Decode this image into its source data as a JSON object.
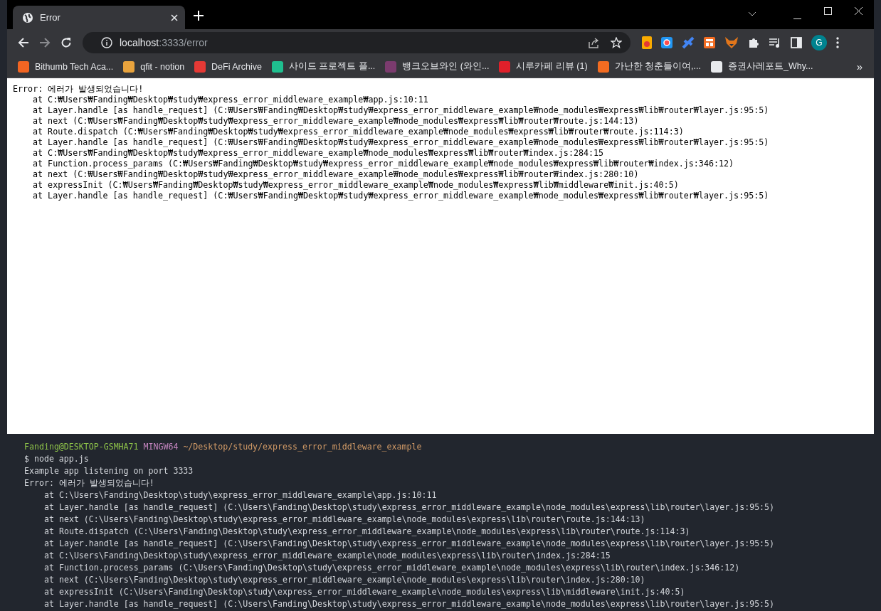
{
  "tab": {
    "title": "Error",
    "selected": true
  },
  "address": {
    "host": "localhost",
    "rest": ":3333/error"
  },
  "profile": {
    "initial": "G"
  },
  "bookmarks": [
    {
      "label": "Bithumb Tech Aca...",
      "color": "#f26522"
    },
    {
      "label": "qfit - notion",
      "color": "#e8a33d"
    },
    {
      "label": "DeFi Archive",
      "color": "#e53935"
    },
    {
      "label": "사이드 프로젝트 플...",
      "color": "#1fbf8f"
    },
    {
      "label": "뱅크오브와인 (와인...",
      "color": "#7b3b6e"
    },
    {
      "label": "시루카페 리뷰 (1)",
      "color": "#e0202a"
    },
    {
      "label": "가난한 청춘들이여,...",
      "color": "#f36c21"
    },
    {
      "label": "증권사레포트_Why...",
      "color": "#e8eaed"
    }
  ],
  "bookmarks_more": "»",
  "page": {
    "message": "Error: 에러가 발생되었습니다!",
    "stack": [
      "at C:₩Users₩Fanding₩Desktop₩study₩express_error_middleware_example₩app.js:10:11",
      "at Layer.handle [as handle_request] (C:₩Users₩Fanding₩Desktop₩study₩express_error_middleware_example₩node_modules₩express₩lib₩router₩layer.js:95:5)",
      "at next (C:₩Users₩Fanding₩Desktop₩study₩express_error_middleware_example₩node_modules₩express₩lib₩router₩route.js:144:13)",
      "at Route.dispatch (C:₩Users₩Fanding₩Desktop₩study₩express_error_middleware_example₩node_modules₩express₩lib₩router₩route.js:114:3)",
      "at Layer.handle [as handle_request] (C:₩Users₩Fanding₩Desktop₩study₩express_error_middleware_example₩node_modules₩express₩lib₩router₩layer.js:95:5)",
      "at C:₩Users₩Fanding₩Desktop₩study₩express_error_middleware_example₩node_modules₩express₩lib₩router₩index.js:284:15",
      "at Function.process_params (C:₩Users₩Fanding₩Desktop₩study₩express_error_middleware_example₩node_modules₩express₩lib₩router₩index.js:346:12)",
      "at next (C:₩Users₩Fanding₩Desktop₩study₩express_error_middleware_example₩node_modules₩express₩lib₩router₩index.js:280:10)",
      "at expressInit (C:₩Users₩Fanding₩Desktop₩study₩express_error_middleware_example₩node_modules₩express₩lib₩middleware₩init.js:40:5)",
      "at Layer.handle [as handle_request] (C:₩Users₩Fanding₩Desktop₩study₩express_error_middleware_example₩node_modules₩express₩lib₩router₩layer.js:95:5)"
    ]
  },
  "terminal": {
    "user_host": "Fanding@DESKTOP-GSMHA71",
    "shell": "MINGW64",
    "cwd": "~/Desktop/study/express_error_middleware_example",
    "command": "$ node app.js",
    "output": [
      "Example app listening on port 3333",
      "Error: 에러가 발생되었습니다!"
    ],
    "stack": [
      "at C:\\Users\\Fanding\\Desktop\\study\\express_error_middleware_example\\app.js:10:11",
      "at Layer.handle [as handle_request] (C:\\Users\\Fanding\\Desktop\\study\\express_error_middleware_example\\node_modules\\express\\lib\\router\\layer.js:95:5)",
      "at next (C:\\Users\\Fanding\\Desktop\\study\\express_error_middleware_example\\node_modules\\express\\lib\\router\\route.js:144:13)",
      "at Route.dispatch (C:\\Users\\Fanding\\Desktop\\study\\express_error_middleware_example\\node_modules\\express\\lib\\router\\route.js:114:3)",
      "at Layer.handle [as handle_request] (C:\\Users\\Fanding\\Desktop\\study\\express_error_middleware_example\\node_modules\\express\\lib\\router\\layer.js:95:5)",
      "at C:\\Users\\Fanding\\Desktop\\study\\express_error_middleware_example\\node_modules\\express\\lib\\router\\index.js:284:15",
      "at Function.process_params (C:\\Users\\Fanding\\Desktop\\study\\express_error_middleware_example\\node_modules\\express\\lib\\router\\index.js:346:12)",
      "at next (C:\\Users\\Fanding\\Desktop\\study\\express_error_middleware_example\\node_modules\\express\\lib\\router\\index.js:280:10)",
      "at expressInit (C:\\Users\\Fanding\\Desktop\\study\\express_error_middleware_example\\node_modules\\express\\lib\\middleware\\init.js:40:5)",
      "at Layer.handle [as handle_request] (C:\\Users\\Fanding\\Desktop\\study\\express_error_middleware_example\\node_modules\\express\\lib\\router\\layer.js:95:5)"
    ]
  }
}
